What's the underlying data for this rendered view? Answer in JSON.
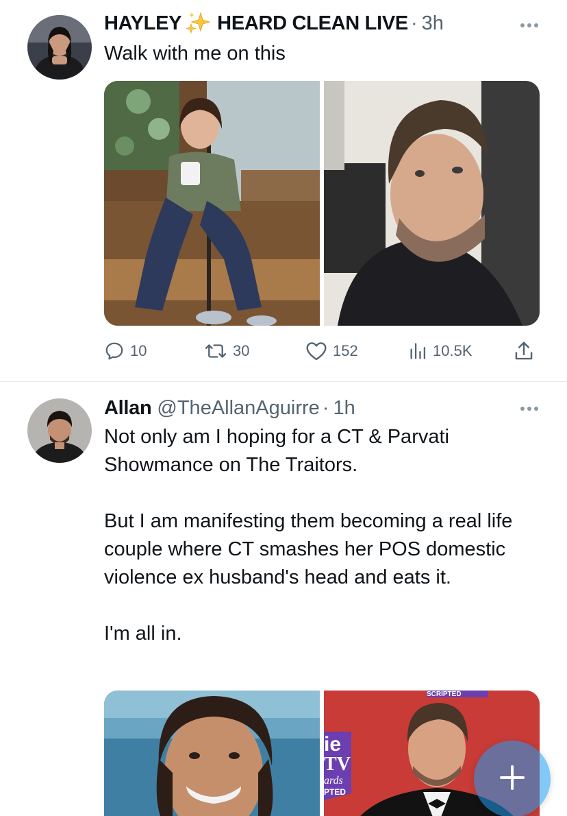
{
  "tweets": [
    {
      "display_name_part1": "HAYLEY",
      "display_name_part2": "HEARD CLEAN LIVE",
      "time": "3h",
      "text": "Walk with me on this",
      "stats": {
        "replies": "10",
        "retweets": "30",
        "likes": "152",
        "views": "10.5K"
      }
    },
    {
      "display_name": "Allan",
      "handle": "@TheAllanAguirre",
      "time": "1h",
      "text": "Not only am I hoping for a CT & Parvati Showmance on The Traitors.\n\nBut I am manifesting them becoming a real life couple where CT smashes her POS domestic violence ex husband's head and eats it.\n\nI'm all in.",
      "media_text": {
        "sign1": "ie",
        "sign2": "TV",
        "sign3": "ards",
        "sign4": "PTED",
        "banner": "SCRIPTED"
      }
    }
  ],
  "separator_dot": "·",
  "fab": {
    "icon": "plus-icon"
  },
  "colors": {
    "accent": "#1d9bf0",
    "secondary_text": "#536471",
    "divider": "#e6e9ec"
  }
}
